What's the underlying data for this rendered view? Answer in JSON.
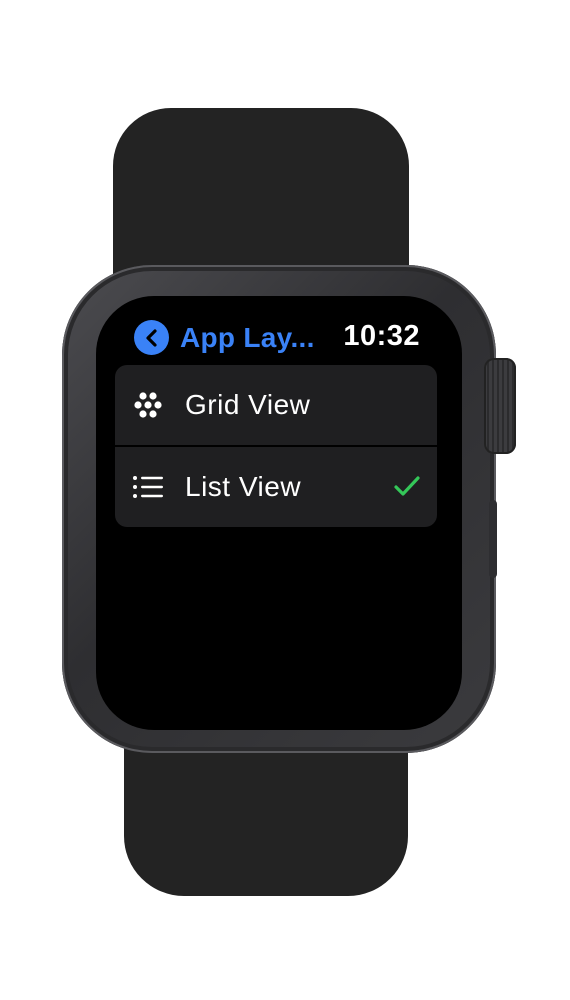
{
  "status_bar": {
    "back_title": "App Lay...",
    "time": "10:32"
  },
  "options": [
    {
      "label": "Grid View",
      "icon": "grid-dots-icon",
      "selected": false
    },
    {
      "label": "List View",
      "icon": "list-icon",
      "selected": true
    }
  ],
  "colors": {
    "accent": "#3a82f7",
    "check": "#34c759",
    "row_background": "#1f1f21",
    "screen_background": "#000000"
  }
}
